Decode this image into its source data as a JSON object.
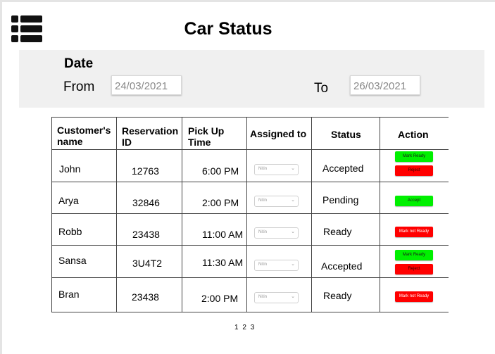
{
  "header": {
    "title": "Car Status"
  },
  "filter": {
    "date_label": "Date",
    "from_label": "From",
    "from_value": "24/03/2021",
    "to_label": "To",
    "to_value": "26/03/2021"
  },
  "table": {
    "columns": [
      "Customer's name",
      "Reservation ID",
      "Pick Up Time",
      "Assigned to",
      "Status",
      "Action"
    ],
    "rows": [
      {
        "name": "John",
        "reservation_id": "12763",
        "pickup": "6:00 PM",
        "assigned": "Nitin",
        "status": "Accepted",
        "actions": [
          {
            "label": "Mark Ready",
            "kind": "green"
          },
          {
            "label": "Reject",
            "kind": "red"
          }
        ]
      },
      {
        "name": "Arya",
        "reservation_id": "32846",
        "pickup": "2:00 PM",
        "assigned": "Nitin",
        "status": "Pending",
        "actions": [
          {
            "label": "Accept",
            "kind": "green"
          }
        ]
      },
      {
        "name": "Robb",
        "reservation_id": "23438",
        "pickup": "11:00 AM",
        "assigned": "Nitin",
        "status": "Ready",
        "actions": [
          {
            "label": "Mark not Ready",
            "kind": "red"
          }
        ]
      },
      {
        "name": "Sansa",
        "reservation_id": "3U4T2",
        "pickup": "11:30 AM",
        "assigned": "Nitin",
        "status": "Accepted",
        "actions": [
          {
            "label": "Mark Ready",
            "kind": "green"
          },
          {
            "label": "Reject",
            "kind": "red"
          }
        ]
      },
      {
        "name": "Bran",
        "reservation_id": "23438",
        "pickup": "2:00 PM",
        "assigned": "Nitin",
        "status": "Ready",
        "actions": [
          {
            "label": "Mark not Ready",
            "kind": "red"
          }
        ]
      }
    ]
  },
  "pagination": {
    "pages": [
      "1",
      "2",
      "3"
    ]
  },
  "colors": {
    "accept_green": "#00f000",
    "reject_red": "#ff0000",
    "filter_bg": "#f0f0f0"
  },
  "icons": {
    "menu": "list-menu-icon",
    "select_chevron": "chevron-down-icon"
  }
}
